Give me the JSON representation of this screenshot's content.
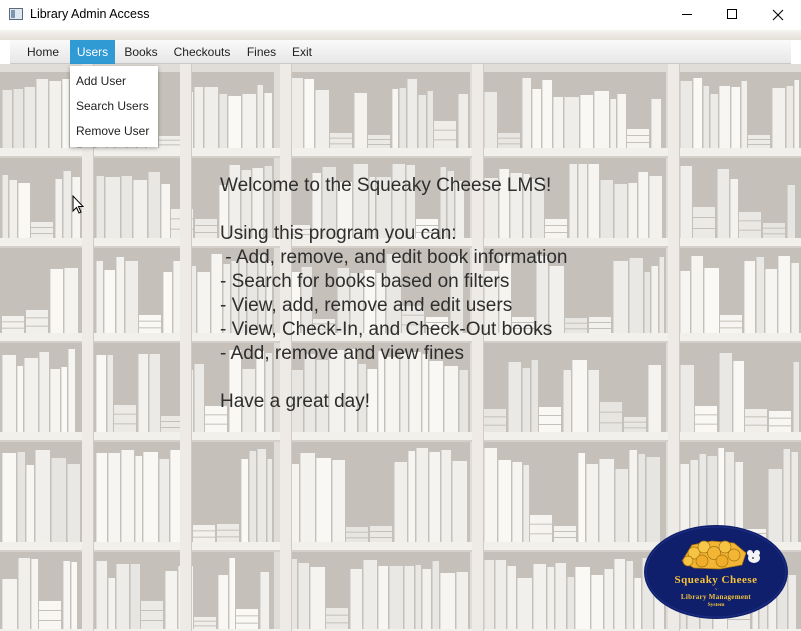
{
  "window": {
    "title": "Library Admin Access"
  },
  "menubar": {
    "items": [
      {
        "label": "Home"
      },
      {
        "label": "Users"
      },
      {
        "label": "Books"
      },
      {
        "label": "Checkouts"
      },
      {
        "label": "Fines"
      },
      {
        "label": "Exit"
      }
    ],
    "active_item": "Users"
  },
  "users_menu": {
    "items": [
      {
        "label": "Add User"
      },
      {
        "label": "Search Users"
      },
      {
        "label": "Remove User"
      }
    ]
  },
  "welcome": {
    "lines": [
      "Welcome to the Squeaky Cheese LMS!",
      "",
      "Using this program you can:",
      " - Add, remove, and edit book information",
      "- Search for books based on filters",
      "- View, add, remove and edit users",
      "- View, Check-In, and Check-Out books",
      "- Add, remove and view fines",
      "",
      "Have a great day!"
    ]
  },
  "logo": {
    "title": "Squeaky Cheese",
    "separator": "~",
    "subtitle_line1": "Library Management",
    "subtitle_line2": "System"
  },
  "colors": {
    "menu_active": "#2f9ad3",
    "logo_background": "#0f1f6b",
    "logo_text": "#f5c43a",
    "shelf_background": "#e4e1dc"
  }
}
